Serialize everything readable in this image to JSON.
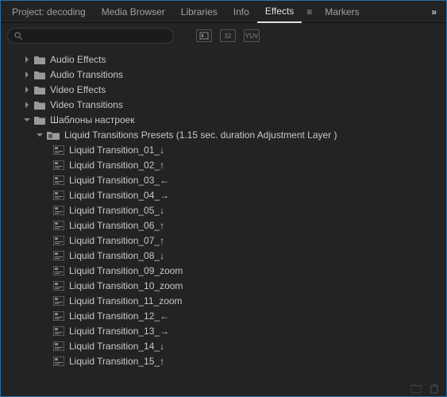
{
  "tabs": {
    "items": [
      {
        "label": "Project: decoding",
        "active": false
      },
      {
        "label": "Media Browser",
        "active": false
      },
      {
        "label": "Libraries",
        "active": false
      },
      {
        "label": "Info",
        "active": false
      },
      {
        "label": "Effects",
        "active": true
      },
      {
        "label": "Markers",
        "active": false
      }
    ],
    "more": "»"
  },
  "search": {
    "placeholder": "",
    "value": ""
  },
  "toolbar_pills": [
    "",
    "32",
    "YUV"
  ],
  "tree": {
    "folders": [
      {
        "label": "Audio Effects",
        "expanded": false
      },
      {
        "label": "Audio Transitions",
        "expanded": false
      },
      {
        "label": "Video Effects",
        "expanded": false
      },
      {
        "label": "Video Transitions",
        "expanded": false
      },
      {
        "label": "Шаблоны настроек",
        "expanded": true
      }
    ],
    "preset_bin": {
      "label": "Liquid Transitions Presets (1.15 sec. duration Adjustment Layer )",
      "expanded": true
    },
    "presets": [
      "Liquid Transition_01_↓",
      "Liquid Transition_02_↑",
      "Liquid Transition_03_←",
      "Liquid Transition_04_→",
      "Liquid Transition_05_↓",
      "Liquid Transition_06_↑",
      "Liquid Transition_07_↑",
      "Liquid Transition_08_↓",
      "Liquid Transition_09_zoom",
      "Liquid Transition_10_zoom",
      "Liquid Transition_11_zoom",
      "Liquid Transition_12_←",
      "Liquid Transition_13_→",
      "Liquid Transition_14_↓",
      "Liquid Transition_15_↑"
    ]
  }
}
